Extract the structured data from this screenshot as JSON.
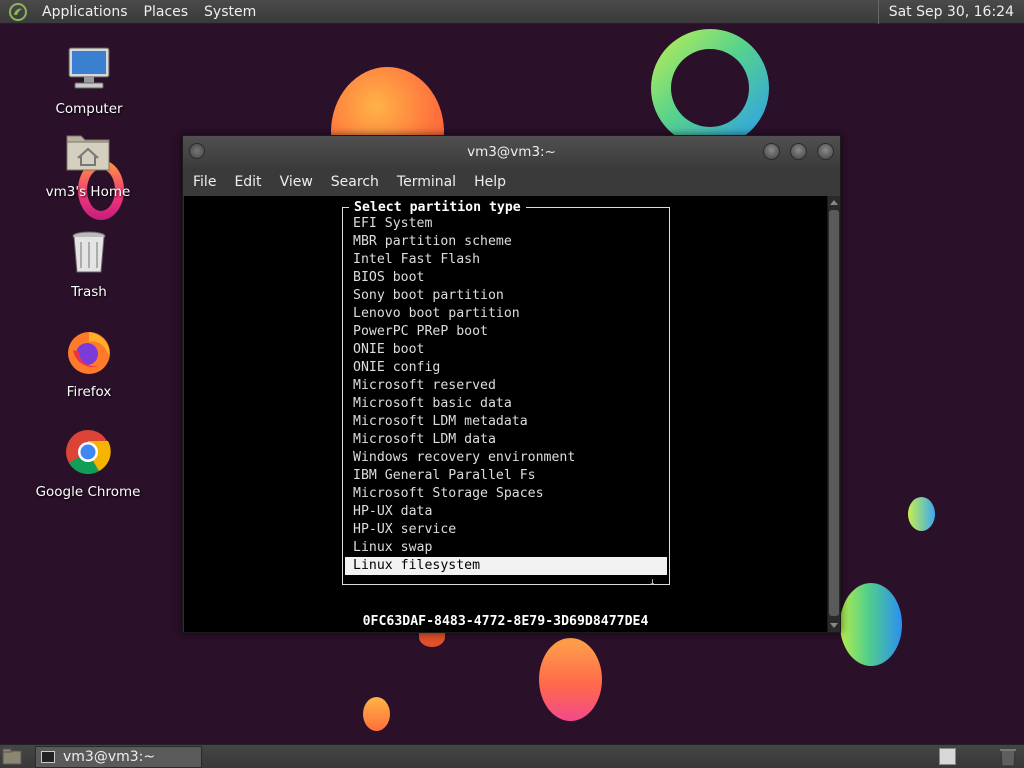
{
  "top_panel": {
    "menus": [
      "Applications",
      "Places",
      "System"
    ],
    "clock": "Sat Sep 30, 16:24"
  },
  "desktop": {
    "icons": [
      {
        "label": "Computer",
        "icon": "computer-icon"
      },
      {
        "label": "vm3's Home",
        "icon": "home-folder-icon"
      },
      {
        "label": "Trash",
        "icon": "trash-icon"
      },
      {
        "label": "Firefox",
        "icon": "firefox-icon"
      },
      {
        "label": "Google Chrome",
        "icon": "chrome-icon"
      }
    ]
  },
  "window": {
    "title": "vm3@vm3:~",
    "menus": [
      "File",
      "Edit",
      "View",
      "Search",
      "Terminal",
      "Help"
    ]
  },
  "dialog": {
    "title": "Select partition type",
    "items": [
      "EFI System",
      "MBR partition scheme",
      "Intel Fast Flash",
      "BIOS boot",
      "Sony boot partition",
      "Lenovo boot partition",
      "PowerPC PReP boot",
      "ONIE boot",
      "ONIE config",
      "Microsoft reserved",
      "Microsoft basic data",
      "Microsoft LDM metadata",
      "Microsoft LDM data",
      "Windows recovery environment",
      "IBM General Parallel Fs",
      "Microsoft Storage Spaces",
      "HP-UX data",
      "HP-UX service",
      "Linux swap",
      "Linux filesystem"
    ],
    "selected": "Linux filesystem",
    "more_indicator": "↓",
    "guid": "0FC63DAF-8483-4772-8E79-3D69D8477DE4"
  },
  "taskbar": {
    "task_label": "vm3@vm3:~"
  }
}
